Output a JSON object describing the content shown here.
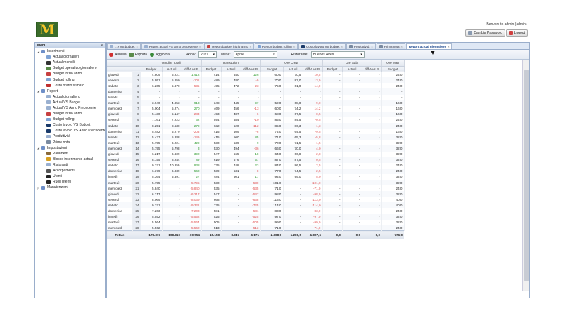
{
  "header": {
    "logo": "M",
    "welcome": "Benvenuto admin (admin).",
    "change_password": "Cambia Password",
    "logout": "Logout"
  },
  "sidebar": {
    "title": "Menu",
    "collapse": "«",
    "items": [
      {
        "label": "Inserimenti",
        "level": 0,
        "icon": "folder-icon",
        "color": "#6e8fc8",
        "toggle": "◢"
      },
      {
        "label": "Actual giornalieri",
        "level": 1,
        "icon": "doc-icon",
        "color": "#7ea2d4"
      },
      {
        "label": "Actual mensili",
        "level": 1,
        "icon": "gear-icon",
        "color": "#333333"
      },
      {
        "label": "Budget operativo giornaliero",
        "level": 1,
        "icon": "table-icon",
        "color": "#5a8a4a"
      },
      {
        "label": "Budget inizio anno",
        "level": 1,
        "icon": "pdf-icon",
        "color": "#c84040"
      },
      {
        "label": "Budget rolling",
        "level": 1,
        "icon": "doc-icon",
        "color": "#7ea2d4"
      },
      {
        "label": "Costo orario stimato",
        "level": 1,
        "icon": "chart-icon",
        "color": "#c03030"
      },
      {
        "label": "Report",
        "level": 0,
        "icon": "folder-icon",
        "color": "#6e8fc8",
        "toggle": "◢"
      },
      {
        "label": "Actual giornaliero",
        "level": 1,
        "icon": "doc-icon",
        "color": "#9ab0d0"
      },
      {
        "label": "Actual VS Budget",
        "level": 1,
        "icon": "doc-icon",
        "color": "#9ab0d0"
      },
      {
        "label": "Actual VS Anno Precedente",
        "level": 1,
        "icon": "doc-icon",
        "color": "#9ab0d0"
      },
      {
        "label": "Budget inizio anno",
        "level": 1,
        "icon": "pdf-icon",
        "color": "#c84040"
      },
      {
        "label": "Budget rolling",
        "level": 1,
        "icon": "doc-icon",
        "color": "#7ea2d4"
      },
      {
        "label": "Costo lavoro VS Budget",
        "level": 1,
        "icon": "pie-icon",
        "color": "#1a3a6a"
      },
      {
        "label": "Costo lavoro VS Anno Precedente",
        "level": 1,
        "icon": "pie-icon",
        "color": "#1a3a6a"
      },
      {
        "label": "Produttività",
        "level": 1,
        "icon": "doc-icon",
        "color": "#9ab0d0"
      },
      {
        "label": "Prime nota",
        "level": 1,
        "icon": "calendar-icon",
        "color": "#7a8aa0"
      },
      {
        "label": "Impostazioni",
        "level": 0,
        "icon": "folder-icon",
        "color": "#6e8fc8",
        "toggle": "◢"
      },
      {
        "label": "Parametri",
        "level": 1,
        "icon": "pencil-icon",
        "color": "#8a6a3a"
      },
      {
        "label": "Blocco inserimento actual",
        "level": 1,
        "icon": "lock-icon",
        "color": "#d8a020"
      },
      {
        "label": "Ristoranti",
        "level": 1,
        "icon": "doc-icon",
        "color": "#9ab0d0"
      },
      {
        "label": "Accorpamenti",
        "level": 1,
        "icon": "merge-icon",
        "color": "#555555"
      },
      {
        "label": "Utenti",
        "level": 1,
        "icon": "user-icon",
        "color": "#222222"
      },
      {
        "label": "Ruoli Utenti",
        "level": 1,
        "icon": "users-icon",
        "color": "#222222"
      },
      {
        "label": "Manutenzioni",
        "level": 0,
        "icon": "folder-icon",
        "color": "#6e8fc8",
        "toggle": "▷"
      }
    ]
  },
  "tabs": [
    {
      "label": "...e VS budget",
      "icon": "doc-icon",
      "color": "#9ab0d0"
    },
    {
      "label": "Report actual VS anno precedente",
      "icon": "doc-icon",
      "color": "#9ab0d0"
    },
    {
      "label": "Report budget inizio anno",
      "icon": "pdf-icon",
      "color": "#c84040"
    },
    {
      "label": "Report budget rolling",
      "icon": "doc-icon",
      "color": "#7ea2d4"
    },
    {
      "label": "Costo lavoro VS budget",
      "icon": "pie-icon",
      "color": "#1a3a6a"
    },
    {
      "label": "Produttività",
      "icon": "calendar-icon",
      "color": "#7a8aa0"
    },
    {
      "label": "Prima nota",
      "icon": "calendar-icon",
      "color": "#7a8aa0"
    },
    {
      "label": "Report actual giornaliero",
      "icon": "",
      "color": "",
      "active": true
    }
  ],
  "toolbar": {
    "cancel": "Annulla",
    "export": "Esporta",
    "refresh": "Aggiorna",
    "year_label": "Anno:",
    "year_value": "2021",
    "month_label": "Mese:",
    "month_value": "aprile",
    "restaurant_label": "Ristorante:",
    "restaurant_value": "Buenos Aires"
  },
  "grid": {
    "groups": [
      "Vendite Totali",
      "Transazioni",
      "Ore Crew",
      "Ore Sala",
      "Ore Man"
    ],
    "subcols": [
      "Budget",
      "Actual",
      "diff A vs B"
    ],
    "rows": [
      [
        "giovedì",
        "1",
        "4.809",
        "6.221",
        "1.412",
        "414",
        "540",
        "126",
        "60,0",
        "70,5",
        "10,5",
        "-",
        "-",
        "-",
        "24,0"
      ],
      [
        "venerdì",
        "2",
        "5.951",
        "5.850",
        "-101",
        "489",
        "480",
        "-9",
        "70,0",
        "83,0",
        "13,0",
        "-",
        "-",
        "-",
        "24,0"
      ],
      [
        "sabato",
        "3",
        "6.205",
        "5.670",
        "-535",
        "495",
        "472",
        "-23",
        "75,0",
        "61,0",
        "-14,0",
        "-",
        "-",
        "-",
        "24,0"
      ],
      [
        "domenica",
        "4",
        "-",
        "-",
        "-",
        "-",
        "-",
        "-",
        "-",
        "-",
        "-",
        "-",
        "-",
        "-",
        "-"
      ],
      [
        "lunedì",
        "5",
        "-",
        "-",
        "-",
        "-",
        "-",
        "-",
        "-",
        "-",
        "-",
        "-",
        "-",
        "-",
        "-"
      ],
      [
        "martedì",
        "6",
        "3.940",
        "4.853",
        "913",
        "348",
        "445",
        "97",
        "59,0",
        "68,0",
        "9,0",
        "-",
        "-",
        "-",
        "16,0"
      ],
      [
        "mercoledì",
        "7",
        "5.004",
        "5.274",
        "270",
        "469",
        "456",
        "-13",
        "60,0",
        "74,2",
        "14,2",
        "-",
        "-",
        "-",
        "16,0"
      ],
      [
        "giovedì",
        "8",
        "5.430",
        "5.147",
        "-283",
        "493",
        "487",
        "-6",
        "68,0",
        "67,5",
        "-0,5",
        "-",
        "-",
        "-",
        "16,0"
      ],
      [
        "venerdì",
        "9",
        "7.161",
        "7.223",
        "62",
        "594",
        "584",
        "-10",
        "85,0",
        "84,5",
        "-0,5",
        "-",
        "-",
        "-",
        "24,0"
      ],
      [
        "sabato",
        "10",
        "8.251",
        "8.530",
        "279",
        "632",
        "520",
        "-112",
        "85,0",
        "86,3",
        "1,3",
        "-",
        "-",
        "-",
        "24,0"
      ],
      [
        "domenica",
        "11",
        "5.482",
        "5.279",
        "-203",
        "415",
        "409",
        "-6",
        "74,0",
        "64,5",
        "-9,5",
        "-",
        "-",
        "-",
        "16,0"
      ],
      [
        "lunedì",
        "12",
        "5.437",
        "5.288",
        "-149",
        "415",
        "500",
        "85",
        "71,0",
        "65,3",
        "-5,8",
        "-",
        "-",
        "-",
        "32,0"
      ],
      [
        "martedì",
        "13",
        "5.795",
        "6.224",
        "429",
        "530",
        "539",
        "9",
        "70,0",
        "71,5",
        "1,5",
        "-",
        "-",
        "-",
        "32,0"
      ],
      [
        "mercoledì",
        "14",
        "5.795",
        "5.798",
        "3",
        "530",
        "494",
        "-36",
        "66,0",
        "70,0",
        "4,0",
        "-",
        "-",
        "-",
        "32,0"
      ],
      [
        "giovedì",
        "15",
        "6.217",
        "6.609",
        "392",
        "547",
        "565",
        "18",
        "64,0",
        "66,8",
        "2,8",
        "-",
        "-",
        "-",
        "32,0"
      ],
      [
        "venerdì",
        "16",
        "8.155",
        "8.244",
        "89",
        "619",
        "676",
        "57",
        "87,0",
        "87,5",
        "0,5",
        "-",
        "-",
        "-",
        "32,0"
      ],
      [
        "sabato",
        "17",
        "9.321",
        "10.259",
        "938",
        "725",
        "748",
        "23",
        "84,0",
        "86,5",
        "2,5",
        "-",
        "-",
        "-",
        "24,0"
      ],
      [
        "domenica",
        "18",
        "6.379",
        "6.939",
        "560",
        "539",
        "531",
        "-8",
        "77,0",
        "74,5",
        "-2,5",
        "-",
        "-",
        "-",
        "24,0"
      ],
      [
        "lunedì",
        "19",
        "5.364",
        "5.391",
        "27",
        "484",
        "501",
        "17",
        "94,0",
        "99,0",
        "5,0",
        "-",
        "-",
        "-",
        "32,0"
      ],
      [
        "martedì",
        "20",
        "5.795",
        "-",
        "-5.795",
        "530",
        "-",
        "-530",
        "101,0",
        "-",
        "-101,0",
        "-",
        "-",
        "-",
        "32,0"
      ],
      [
        "mercoledì",
        "21",
        "5.840",
        "-",
        "-5.840",
        "535",
        "-",
        "-535",
        "71,0",
        "-",
        "-71,0",
        "-",
        "-",
        "-",
        "24,0"
      ],
      [
        "giovedì",
        "22",
        "6.217",
        "-",
        "-6.217",
        "547",
        "-",
        "-547",
        "98,0",
        "-",
        "-98,0",
        "-",
        "-",
        "-",
        "32,0"
      ],
      [
        "venerdì",
        "23",
        "8.069",
        "-",
        "-8.069",
        "668",
        "-",
        "-668",
        "113,0",
        "-",
        "-113,0",
        "-",
        "-",
        "-",
        "40,0"
      ],
      [
        "sabato",
        "24",
        "9.321",
        "-",
        "-9.321",
        "725",
        "-",
        "-725",
        "114,0",
        "-",
        "-114,0",
        "-",
        "-",
        "-",
        "40,0"
      ],
      [
        "domenica",
        "25",
        "7.203",
        "-",
        "-7.203",
        "581",
        "-",
        "-581",
        "83,0",
        "-",
        "-83,0",
        "-",
        "-",
        "-",
        "24,0"
      ],
      [
        "lunedì",
        "26",
        "5.552",
        "-",
        "-5.552",
        "525",
        "-",
        "-525",
        "97,0",
        "-",
        "-97,0",
        "-",
        "-",
        "-",
        "32,0"
      ],
      [
        "martedì",
        "27",
        "5.564",
        "-",
        "-5.564",
        "505",
        "-",
        "-505",
        "99,0",
        "-",
        "-99,0",
        "-",
        "-",
        "-",
        "32,0"
      ],
      [
        "mercoledì",
        "28",
        "5.562",
        "-",
        "-5.562",
        "513",
        "-",
        "-513",
        "71,0",
        "-",
        "-71,0",
        "-",
        "-",
        "-",
        "24,0"
      ]
    ],
    "totals": [
      "Totale",
      "",
      "178.373",
      "108.819",
      "-69.554",
      "15.158",
      "8.947",
      "-6.171",
      "2.308,0",
      "1.280,5",
      "-1.027,6",
      "0,0",
      "0,0",
      "0,0",
      "776,0"
    ]
  },
  "colors": {
    "negative": "#e05050",
    "positive": "#2e9a2e",
    "header_bg": "#dfe8f5",
    "border": "#9aaecb"
  }
}
